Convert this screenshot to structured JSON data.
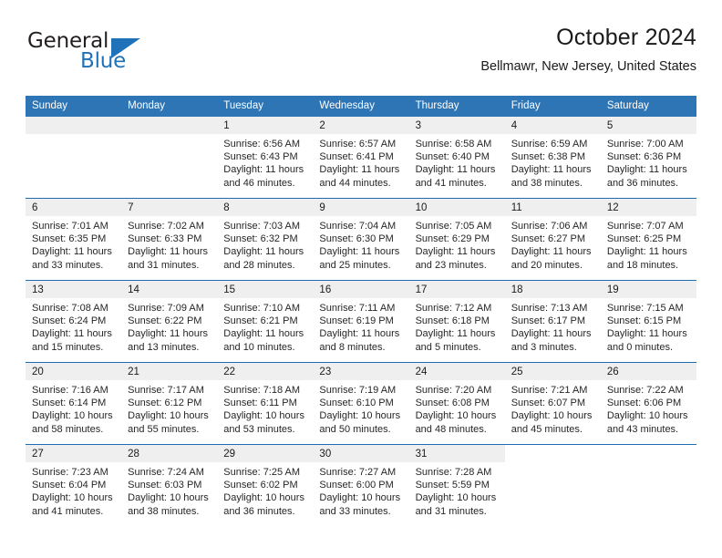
{
  "brand": {
    "name_part1": "General",
    "name_part2": "Blue",
    "logo_icon": "triangle-flag-icon",
    "accent_color": "#1f72b8"
  },
  "header": {
    "title": "October 2024",
    "subtitle": "Bellmawr, New Jersey, United States"
  },
  "calendar": {
    "header_color": "#2e75b6",
    "band_color": "#efefef",
    "separator_color": "#1f6cb0",
    "weekday_headers": [
      "Sunday",
      "Monday",
      "Tuesday",
      "Wednesday",
      "Thursday",
      "Friday",
      "Saturday"
    ],
    "weeks": [
      {
        "band_full": true,
        "days": [
          {
            "date": "",
            "lines": []
          },
          {
            "date": "",
            "lines": []
          },
          {
            "date": "1",
            "lines": [
              "Sunrise: 6:56 AM",
              "Sunset: 6:43 PM",
              "Daylight: 11 hours",
              "and 46 minutes."
            ]
          },
          {
            "date": "2",
            "lines": [
              "Sunrise: 6:57 AM",
              "Sunset: 6:41 PM",
              "Daylight: 11 hours",
              "and 44 minutes."
            ]
          },
          {
            "date": "3",
            "lines": [
              "Sunrise: 6:58 AM",
              "Sunset: 6:40 PM",
              "Daylight: 11 hours",
              "and 41 minutes."
            ]
          },
          {
            "date": "4",
            "lines": [
              "Sunrise: 6:59 AM",
              "Sunset: 6:38 PM",
              "Daylight: 11 hours",
              "and 38 minutes."
            ]
          },
          {
            "date": "5",
            "lines": [
              "Sunrise: 7:00 AM",
              "Sunset: 6:36 PM",
              "Daylight: 11 hours",
              "and 36 minutes."
            ]
          }
        ]
      },
      {
        "band_full": true,
        "days": [
          {
            "date": "6",
            "lines": [
              "Sunrise: 7:01 AM",
              "Sunset: 6:35 PM",
              "Daylight: 11 hours",
              "and 33 minutes."
            ]
          },
          {
            "date": "7",
            "lines": [
              "Sunrise: 7:02 AM",
              "Sunset: 6:33 PM",
              "Daylight: 11 hours",
              "and 31 minutes."
            ]
          },
          {
            "date": "8",
            "lines": [
              "Sunrise: 7:03 AM",
              "Sunset: 6:32 PM",
              "Daylight: 11 hours",
              "and 28 minutes."
            ]
          },
          {
            "date": "9",
            "lines": [
              "Sunrise: 7:04 AM",
              "Sunset: 6:30 PM",
              "Daylight: 11 hours",
              "and 25 minutes."
            ]
          },
          {
            "date": "10",
            "lines": [
              "Sunrise: 7:05 AM",
              "Sunset: 6:29 PM",
              "Daylight: 11 hours",
              "and 23 minutes."
            ]
          },
          {
            "date": "11",
            "lines": [
              "Sunrise: 7:06 AM",
              "Sunset: 6:27 PM",
              "Daylight: 11 hours",
              "and 20 minutes."
            ]
          },
          {
            "date": "12",
            "lines": [
              "Sunrise: 7:07 AM",
              "Sunset: 6:25 PM",
              "Daylight: 11 hours",
              "and 18 minutes."
            ]
          }
        ]
      },
      {
        "band_full": true,
        "days": [
          {
            "date": "13",
            "lines": [
              "Sunrise: 7:08 AM",
              "Sunset: 6:24 PM",
              "Daylight: 11 hours",
              "and 15 minutes."
            ]
          },
          {
            "date": "14",
            "lines": [
              "Sunrise: 7:09 AM",
              "Sunset: 6:22 PM",
              "Daylight: 11 hours",
              "and 13 minutes."
            ]
          },
          {
            "date": "15",
            "lines": [
              "Sunrise: 7:10 AM",
              "Sunset: 6:21 PM",
              "Daylight: 11 hours",
              "and 10 minutes."
            ]
          },
          {
            "date": "16",
            "lines": [
              "Sunrise: 7:11 AM",
              "Sunset: 6:19 PM",
              "Daylight: 11 hours",
              "and 8 minutes."
            ]
          },
          {
            "date": "17",
            "lines": [
              "Sunrise: 7:12 AM",
              "Sunset: 6:18 PM",
              "Daylight: 11 hours",
              "and 5 minutes."
            ]
          },
          {
            "date": "18",
            "lines": [
              "Sunrise: 7:13 AM",
              "Sunset: 6:17 PM",
              "Daylight: 11 hours",
              "and 3 minutes."
            ]
          },
          {
            "date": "19",
            "lines": [
              "Sunrise: 7:15 AM",
              "Sunset: 6:15 PM",
              "Daylight: 11 hours",
              "and 0 minutes."
            ]
          }
        ]
      },
      {
        "band_full": true,
        "days": [
          {
            "date": "20",
            "lines": [
              "Sunrise: 7:16 AM",
              "Sunset: 6:14 PM",
              "Daylight: 10 hours",
              "and 58 minutes."
            ]
          },
          {
            "date": "21",
            "lines": [
              "Sunrise: 7:17 AM",
              "Sunset: 6:12 PM",
              "Daylight: 10 hours",
              "and 55 minutes."
            ]
          },
          {
            "date": "22",
            "lines": [
              "Sunrise: 7:18 AM",
              "Sunset: 6:11 PM",
              "Daylight: 10 hours",
              "and 53 minutes."
            ]
          },
          {
            "date": "23",
            "lines": [
              "Sunrise: 7:19 AM",
              "Sunset: 6:10 PM",
              "Daylight: 10 hours",
              "and 50 minutes."
            ]
          },
          {
            "date": "24",
            "lines": [
              "Sunrise: 7:20 AM",
              "Sunset: 6:08 PM",
              "Daylight: 10 hours",
              "and 48 minutes."
            ]
          },
          {
            "date": "25",
            "lines": [
              "Sunrise: 7:21 AM",
              "Sunset: 6:07 PM",
              "Daylight: 10 hours",
              "and 45 minutes."
            ]
          },
          {
            "date": "26",
            "lines": [
              "Sunrise: 7:22 AM",
              "Sunset: 6:06 PM",
              "Daylight: 10 hours",
              "and 43 minutes."
            ]
          }
        ]
      },
      {
        "band_full": false,
        "days": [
          {
            "date": "27",
            "lines": [
              "Sunrise: 7:23 AM",
              "Sunset: 6:04 PM",
              "Daylight: 10 hours",
              "and 41 minutes."
            ]
          },
          {
            "date": "28",
            "lines": [
              "Sunrise: 7:24 AM",
              "Sunset: 6:03 PM",
              "Daylight: 10 hours",
              "and 38 minutes."
            ]
          },
          {
            "date": "29",
            "lines": [
              "Sunrise: 7:25 AM",
              "Sunset: 6:02 PM",
              "Daylight: 10 hours",
              "and 36 minutes."
            ]
          },
          {
            "date": "30",
            "lines": [
              "Sunrise: 7:27 AM",
              "Sunset: 6:00 PM",
              "Daylight: 10 hours",
              "and 33 minutes."
            ]
          },
          {
            "date": "31",
            "lines": [
              "Sunrise: 7:28 AM",
              "Sunset: 5:59 PM",
              "Daylight: 10 hours",
              "and 31 minutes."
            ]
          },
          {
            "date": "",
            "lines": []
          },
          {
            "date": "",
            "lines": []
          }
        ]
      }
    ]
  }
}
